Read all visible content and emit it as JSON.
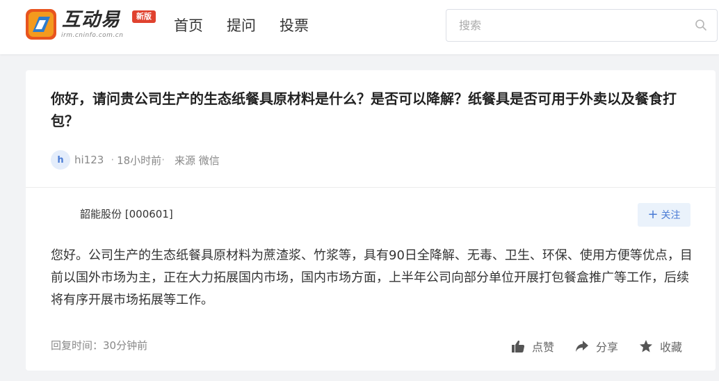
{
  "header": {
    "logo": {
      "title": "互动易",
      "subtitle": "irm.cninfo.com.cn",
      "badge": "新版"
    },
    "nav": [
      {
        "label": "首页"
      },
      {
        "label": "提问"
      },
      {
        "label": "投票"
      }
    ],
    "search": {
      "placeholder": "搜索",
      "icon": "search-icon"
    }
  },
  "question": {
    "title": "你好，请问贵公司生产的生态纸餐具原材料是什么？是否可以降解？纸餐具是否可用于外卖以及餐食打包？",
    "avatar_letter": "h",
    "user": "hi123",
    "time": "18小时前",
    "source": "来源 微信"
  },
  "answer": {
    "company": "韶能股份 [000601]",
    "follow_label": "关注",
    "text": "您好。公司生产的生态纸餐具原材料为蔗渣浆、竹浆等，具有90日全降解、无毒、卫生、环保、使用方便等优点，目前以国外市场为主，正在大力拓展国内市场，国内市场方面，上半年公司向部分单位开展打包餐盒推广等工作，后续将有序开展市场拓展等工作。",
    "reply_time": "回复时间：30分钟前",
    "actions": [
      {
        "label": "点赞",
        "icon": "thumbs-up-icon"
      },
      {
        "label": "分享",
        "icon": "share-icon"
      },
      {
        "label": "收藏",
        "icon": "star-icon"
      }
    ]
  },
  "colors": {
    "accent": "#4a7bd4",
    "badge": "#e0422f",
    "background": "#f2f3f5"
  }
}
